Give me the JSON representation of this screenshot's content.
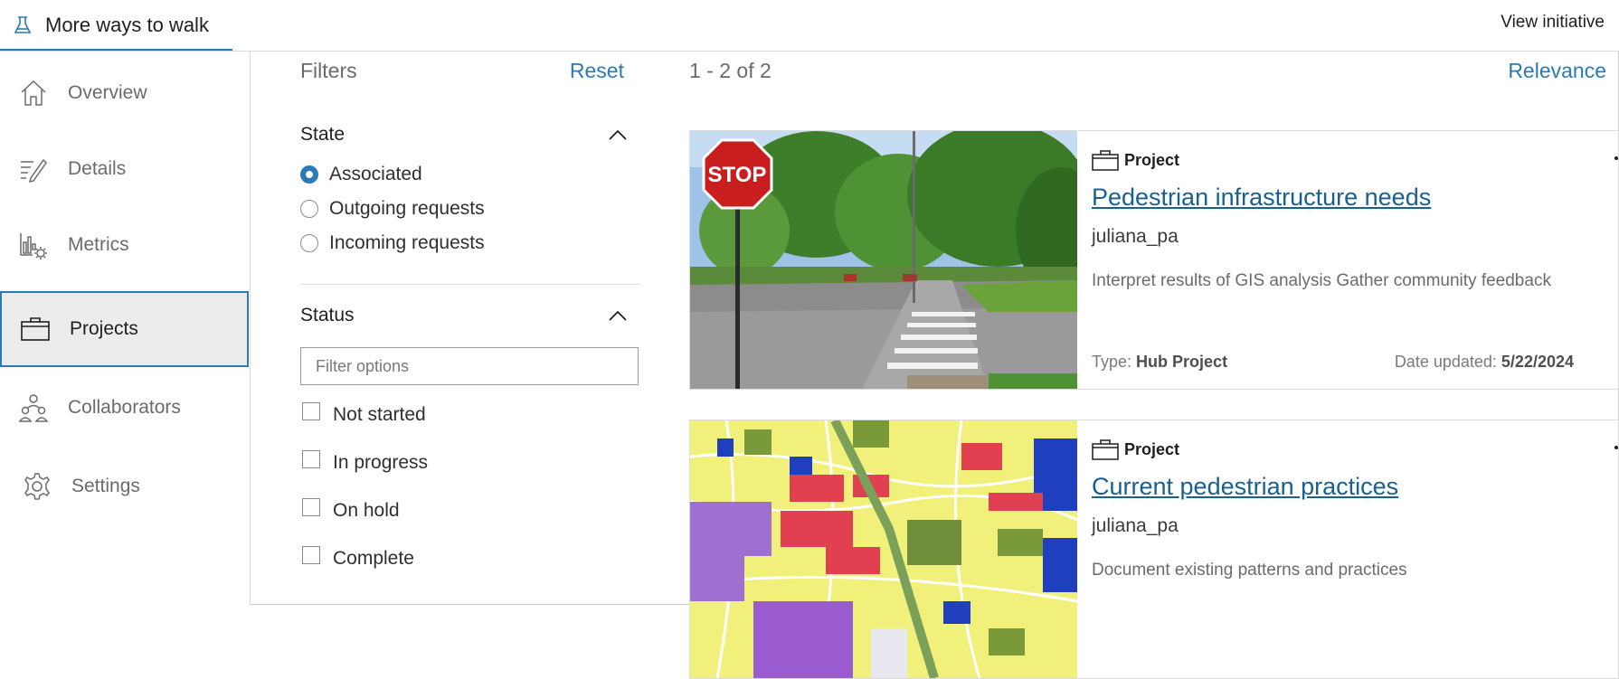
{
  "topbar": {
    "title": "More ways to walk",
    "view_initiative": "View initiative"
  },
  "sidebar": {
    "items": [
      {
        "label": "Overview",
        "icon": "home-icon"
      },
      {
        "label": "Details",
        "icon": "edit-icon"
      },
      {
        "label": "Metrics",
        "icon": "metrics-icon"
      },
      {
        "label": "Projects",
        "icon": "briefcase-icon",
        "active": true
      },
      {
        "label": "Collaborators",
        "icon": "people-icon"
      },
      {
        "label": "Settings",
        "icon": "gear-icon"
      }
    ]
  },
  "filters": {
    "title": "Filters",
    "reset": "Reset",
    "state": {
      "title": "State",
      "options": [
        "Associated",
        "Outgoing requests",
        "Incoming requests"
      ],
      "selected": "Associated"
    },
    "status": {
      "title": "Status",
      "placeholder": "Filter options",
      "options": [
        "Not started",
        "In progress",
        "On hold",
        "Complete"
      ]
    }
  },
  "results": {
    "count": "1 - 2 of 2",
    "sort": "Relevance",
    "cards": [
      {
        "type": "Project",
        "title": "Pedestrian infrastructure needs",
        "owner": "juliana_pa",
        "description": "Interpret results of GIS analysis Gather community feedback",
        "type_label": "Type:",
        "type_value": "Hub Project",
        "date_label": "Date updated:",
        "date_value": "5/22/2024"
      },
      {
        "type": "Project",
        "title": "Current pedestrian practices",
        "owner": "juliana_pa",
        "description": "Document existing patterns and practices"
      }
    ]
  },
  "colors": {
    "accent": "#2a7ab5",
    "link": "#1a5f94",
    "active_bg": "#ececec"
  }
}
